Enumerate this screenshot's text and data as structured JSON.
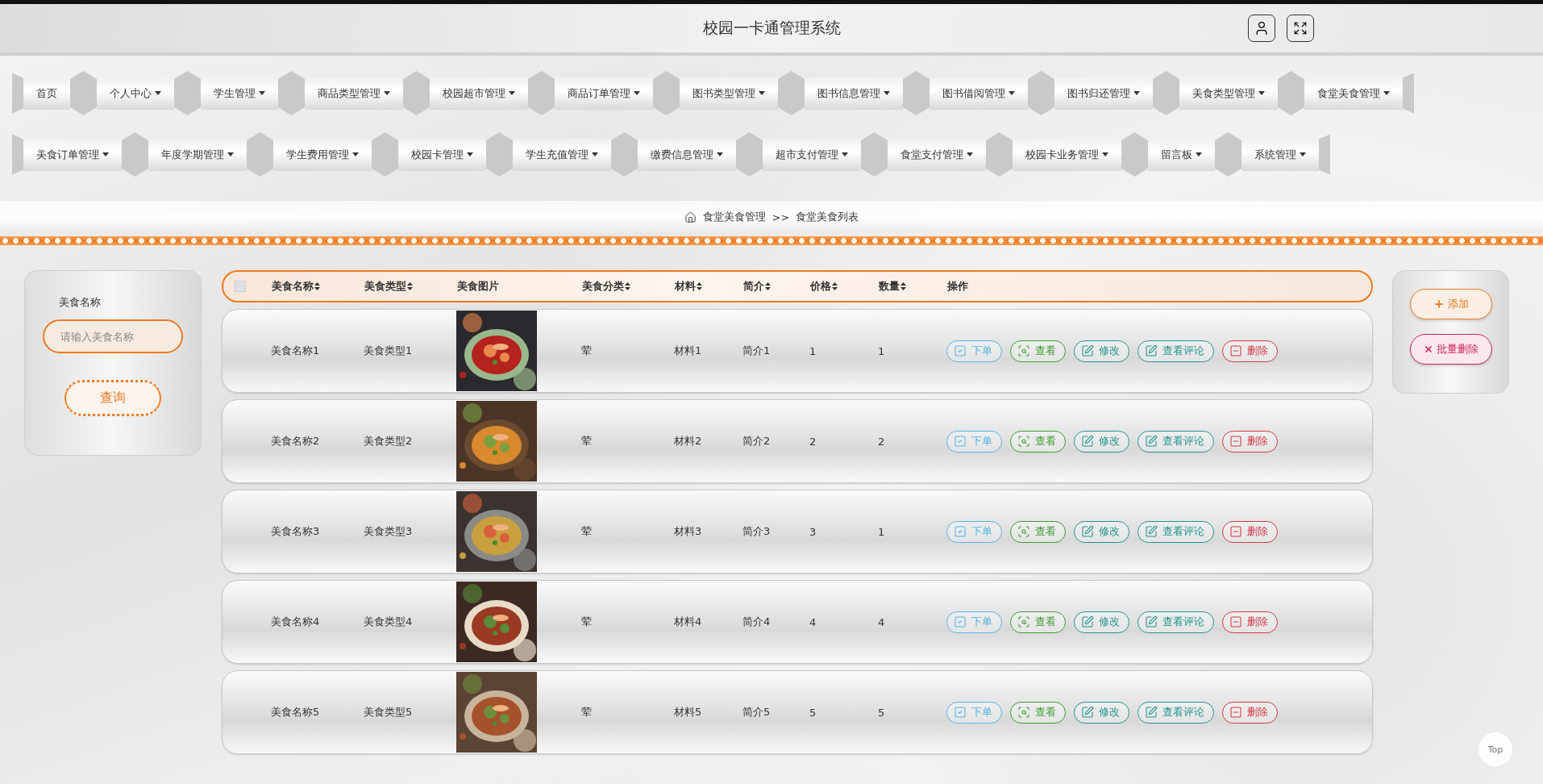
{
  "header": {
    "title": "校园一卡通管理系统"
  },
  "nav": {
    "rows": [
      [
        {
          "label": "首页",
          "caret": false
        },
        {
          "label": "个人中心",
          "caret": true
        },
        {
          "label": "学生管理",
          "caret": true
        },
        {
          "label": "商品类型管理",
          "caret": true
        },
        {
          "label": "校园超市管理",
          "caret": true
        },
        {
          "label": "商品订单管理",
          "caret": true
        },
        {
          "label": "图书类型管理",
          "caret": true
        },
        {
          "label": "图书信息管理",
          "caret": true
        },
        {
          "label": "图书借阅管理",
          "caret": true
        },
        {
          "label": "图书归还管理",
          "caret": true
        },
        {
          "label": "美食类型管理",
          "caret": true
        },
        {
          "label": "食堂美食管理",
          "caret": true
        }
      ],
      [
        {
          "label": "美食订单管理",
          "caret": true
        },
        {
          "label": "年度学期管理",
          "caret": true
        },
        {
          "label": "学生费用管理",
          "caret": true
        },
        {
          "label": "校园卡管理",
          "caret": true
        },
        {
          "label": "学生充值管理",
          "caret": true
        },
        {
          "label": "缴费信息管理",
          "caret": true
        },
        {
          "label": "超市支付管理",
          "caret": true
        },
        {
          "label": "食堂支付管理",
          "caret": true
        },
        {
          "label": "校园卡业务管理",
          "caret": true
        },
        {
          "label": "留言板",
          "caret": true
        },
        {
          "label": "系统管理",
          "caret": true
        }
      ]
    ]
  },
  "breadcrumb": {
    "parent": "食堂美食管理",
    "separator": ">>",
    "current": "食堂美食列表"
  },
  "search": {
    "label": "美食名称",
    "placeholder": "请输入美食名称",
    "button": "查询"
  },
  "table": {
    "select_all": {
      "checked": false
    },
    "columns": [
      {
        "label": "美食名称",
        "sortable": true
      },
      {
        "label": "美食类型",
        "sortable": true
      },
      {
        "label": "美食图片",
        "sortable": false
      },
      {
        "label": "美食分类",
        "sortable": true
      },
      {
        "label": "材料",
        "sortable": true
      },
      {
        "label": "简介",
        "sortable": true
      },
      {
        "label": "价格",
        "sortable": true
      },
      {
        "label": "数量",
        "sortable": true
      },
      {
        "label": "操作",
        "sortable": false
      }
    ],
    "rows": [
      {
        "name": "美食名称1",
        "type": "美食类型1",
        "category": "荤",
        "material": "材料1",
        "intro": "简介1",
        "price": "1",
        "quantity": "1",
        "actions": [
          {
            "label": "下单",
            "kind": "order"
          },
          {
            "label": "查看",
            "kind": "view"
          },
          {
            "label": "修改",
            "kind": "edit"
          },
          {
            "label": "查看评论",
            "kind": "comments"
          },
          {
            "label": "删除",
            "kind": "delete"
          }
        ]
      },
      {
        "name": "美食名称2",
        "type": "美食类型2",
        "category": "荤",
        "material": "材料2",
        "intro": "简介2",
        "price": "2",
        "quantity": "2",
        "actions": [
          {
            "label": "下单",
            "kind": "order"
          },
          {
            "label": "查看",
            "kind": "view"
          },
          {
            "label": "修改",
            "kind": "edit"
          },
          {
            "label": "查看评论",
            "kind": "comments"
          },
          {
            "label": "删除",
            "kind": "delete"
          }
        ]
      },
      {
        "name": "美食名称3",
        "type": "美食类型3",
        "category": "荤",
        "material": "材料3",
        "intro": "简介3",
        "price": "3",
        "quantity": "1",
        "actions": [
          {
            "label": "下单",
            "kind": "order"
          },
          {
            "label": "查看",
            "kind": "view"
          },
          {
            "label": "修改",
            "kind": "edit"
          },
          {
            "label": "查看评论",
            "kind": "comments"
          },
          {
            "label": "删除",
            "kind": "delete"
          }
        ]
      },
      {
        "name": "美食名称4",
        "type": "美食类型4",
        "category": "荤",
        "material": "材料4",
        "intro": "简介4",
        "price": "4",
        "quantity": "4",
        "actions": [
          {
            "label": "下单",
            "kind": "order"
          },
          {
            "label": "查看",
            "kind": "view"
          },
          {
            "label": "修改",
            "kind": "edit"
          },
          {
            "label": "查看评论",
            "kind": "comments"
          },
          {
            "label": "删除",
            "kind": "delete"
          }
        ]
      },
      {
        "name": "美食名称5",
        "type": "美食类型5",
        "category": "荤",
        "material": "材料5",
        "intro": "简介5",
        "price": "5",
        "quantity": "5",
        "actions": [
          {
            "label": "下单",
            "kind": "order"
          },
          {
            "label": "查看",
            "kind": "view"
          },
          {
            "label": "修改",
            "kind": "edit"
          },
          {
            "label": "查看评论",
            "kind": "comments"
          },
          {
            "label": "删除",
            "kind": "delete"
          }
        ]
      }
    ]
  },
  "side_actions": [
    {
      "label": "添加",
      "kind": "add"
    },
    {
      "label": "批量删除",
      "kind": "batch-delete"
    }
  ],
  "top_button": "Top"
}
